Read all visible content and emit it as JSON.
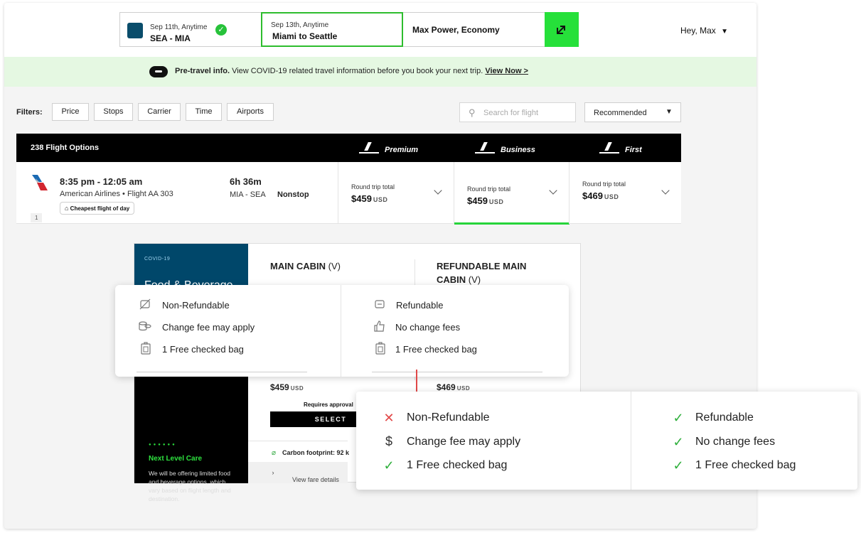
{
  "header": {
    "seg1": {
      "date": "Sep 11th, Anytime",
      "route": "SEA - MIA"
    },
    "seg2": {
      "date": "Sep 13th, Anytime",
      "route": "Miami to Seattle"
    },
    "seg3": {
      "label": "Max Power, Economy"
    },
    "greeting": "Hey, Max"
  },
  "banner": {
    "bold": "Pre-travel info.",
    "text": "View COVID-19 related travel information before you book your next trip.",
    "link": "View Now >"
  },
  "filters": {
    "label": "Filters:",
    "items": [
      "Price",
      "Stops",
      "Carrier",
      "Time",
      "Airports"
    ],
    "search_placeholder": "Search for flight",
    "sort": "Recommended"
  },
  "results": {
    "count": "238 Flight Options",
    "cabins": [
      "Premium",
      "Business",
      "First"
    ]
  },
  "flight": {
    "time": "8:35 pm - 12:05 am",
    "airline": "American Airlines • Flight AA 303",
    "badge": "Cheapest flight of day",
    "index": "1",
    "duration": "6h 36m",
    "route": "MIA - SEA",
    "stops": "Nonstop",
    "fares": [
      {
        "label": "Round trip total",
        "price": "$459",
        "currency": "USD"
      },
      {
        "label": "Round trip total",
        "price": "$459",
        "currency": "USD"
      },
      {
        "label": "Round trip total",
        "price": "$469",
        "currency": "USD"
      }
    ]
  },
  "details": {
    "covid_label": "COVID-19",
    "covid_head": "Food & Beverage",
    "care_title": "Next Level Care",
    "care_desc": "We will be offering limited food and beverage options, which vary based on flight length and destination.",
    "col1_title": "MAIN CABIN",
    "col1_code": "(V)",
    "col2_title_line1": "REFUNDABLE MAIN",
    "col2_title_line2": "CABIN",
    "col2_code": "(V)",
    "price1": "$459",
    "price2": "$469",
    "currency": "USD",
    "requires": "Requires approval",
    "select": "SELECT",
    "carbon": "Carbon footprint: 92 k",
    "fare_details": "View fare details"
  },
  "popup_old": {
    "left": [
      "Non-Refundable",
      "Change fee may apply",
      "1 Free checked bag"
    ],
    "right": [
      "Refundable",
      "No change fees",
      "1 Free checked bag"
    ]
  },
  "popup_new": {
    "left": [
      "Non-Refundable",
      "Change fee may apply",
      "1 Free checked bag"
    ],
    "right": [
      "Refundable",
      "No change fees",
      "1 Free checked bag"
    ]
  },
  "colors": {
    "accent_green": "#26e03a",
    "banner_bg": "#e5f8e2",
    "navy": "#00476a",
    "red": "#e24848"
  }
}
